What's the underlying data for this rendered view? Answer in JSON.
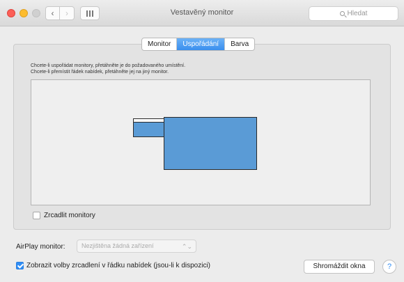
{
  "window": {
    "title": "Vestavěný monitor"
  },
  "toolbar": {
    "back_icon": "chevron-left-icon",
    "forward_icon": "chevron-right-icon",
    "show_all_icon": "grid-icon",
    "search_placeholder": "Hledat",
    "back_glyph": "‹",
    "forward_glyph": "›"
  },
  "tabs": [
    {
      "label": "Monitor",
      "active": false
    },
    {
      "label": "Uspořádání",
      "active": true
    },
    {
      "label": "Barva",
      "active": false
    }
  ],
  "arrangement": {
    "hint_line1": "Chcete-li uspořádat monitory, přetáhněte je do požadovaného umístění.",
    "hint_line2": "Chcete-li přemístit řádek nabídek, přetáhněte jej na jiný monitor.",
    "monitors": [
      {
        "name": "secondary-monitor",
        "has_menu_bar": true
      },
      {
        "name": "primary-monitor",
        "has_menu_bar": false
      }
    ],
    "mirror_label": "Zrcadlit monitory",
    "mirror_checked": false
  },
  "airplay": {
    "label": "AirPlay monitor:",
    "selected": "Nezjištěna žádná zařízení",
    "updown_glyph": "⌃⌄"
  },
  "footer": {
    "show_options_label": "Zobrazit volby zrcadlení v řádku nabídek (jsou-li k dispozici)",
    "show_options_checked": true,
    "gather_windows_label": "Shromáždit okna",
    "help_label": "?"
  },
  "colors": {
    "accent": "#3a8fee",
    "monitor_fill": "#5a9bd6",
    "close": "#fc5f57",
    "minimize": "#fdbc2e"
  }
}
